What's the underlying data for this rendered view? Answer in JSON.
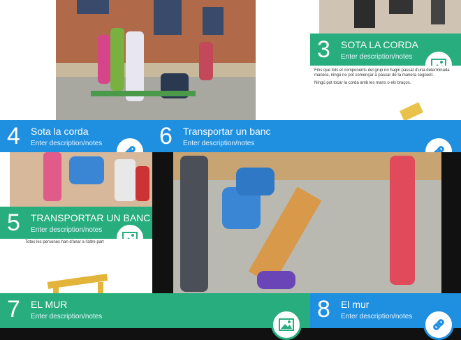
{
  "tiles": [
    {
      "num": "3",
      "title": "SOTA LA CORDA",
      "desc": "Enter description/notes"
    },
    {
      "num": "4",
      "title": "Sota la corda",
      "desc": "Enter description/notes"
    },
    {
      "num": "5",
      "title": "TRANSPORTAR UN BANC",
      "desc": "Enter description/notes"
    },
    {
      "num": "6",
      "title": "Transportar un banc",
      "desc": "Enter description/notes"
    },
    {
      "num": "7",
      "title": "EL MUR",
      "desc": "Enter description/notes"
    },
    {
      "num": "8",
      "title": "El mur",
      "desc": "Enter description/notes"
    }
  ],
  "doc3": {
    "para1": "Fins que tots el components del grup no hagin passat d'una determinada manera, ningú no pot començar a passar de la manera següent.",
    "para2": "Ningú pot tocar la corda amb les mans o els braços."
  },
  "doc5": {
    "line": "Totes les persones han d'anar a l'altre part"
  },
  "colors": {
    "green": "#27ad7e",
    "blue": "#1f8fe0"
  }
}
